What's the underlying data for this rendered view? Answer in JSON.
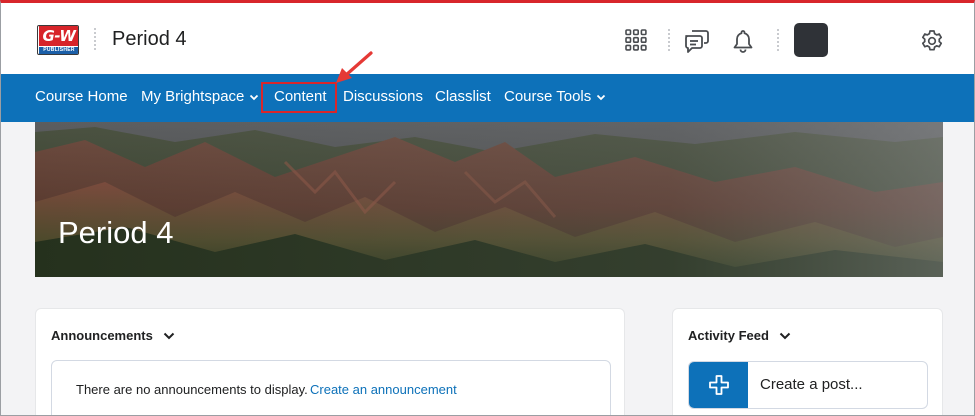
{
  "header": {
    "logo_text": "G-W",
    "logo_subtext": "PUBLISHER",
    "course_title": "Period 4",
    "icons": [
      "apps-grid-icon",
      "chat-icon",
      "bell-icon",
      "avatar",
      "gear-icon"
    ]
  },
  "nav": {
    "items": [
      {
        "label": "Course Home",
        "has_dropdown": false
      },
      {
        "label": "My Brightspace",
        "has_dropdown": true
      },
      {
        "label": "Content",
        "has_dropdown": false,
        "highlighted": true
      },
      {
        "label": "Discussions",
        "has_dropdown": false
      },
      {
        "label": "Classlist",
        "has_dropdown": false
      },
      {
        "label": "Course Tools",
        "has_dropdown": true
      }
    ]
  },
  "banner": {
    "title": "Period 4"
  },
  "announcements": {
    "heading": "Announcements",
    "empty_text": "There are no announcements to display.",
    "create_link": "Create an announcement"
  },
  "activity_feed": {
    "heading": "Activity Feed",
    "create_post": "Create a post..."
  },
  "colors": {
    "accent": "#0d71b9",
    "highlight": "#d8262b",
    "brand_red": "#d7242a"
  }
}
